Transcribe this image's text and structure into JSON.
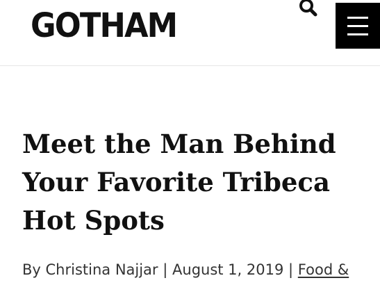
{
  "header": {
    "logo_text": "GOTHAM",
    "search_icon": "search-icon",
    "menu_icon": "hamburger-menu-icon"
  },
  "article": {
    "title_lines": [
      "Meet the Man Behind",
      "Your Favorite Tribeca",
      "Hot Spots"
    ],
    "byline": {
      "author": "By Christina Najjar",
      "separator": "|",
      "date": "August 1, 2019",
      "category": "Food &"
    }
  },
  "colors": {
    "text": "#111111",
    "menu_background": "#000000",
    "header_divider": "#e6e6e6"
  }
}
